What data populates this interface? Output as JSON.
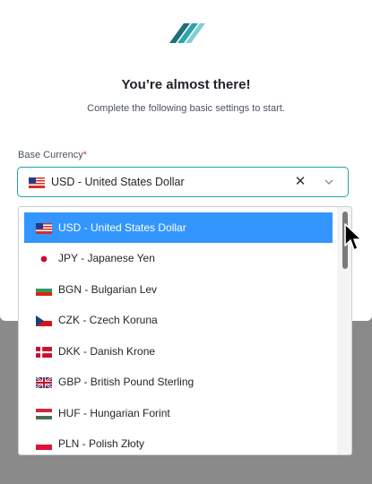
{
  "modal": {
    "title": "You’re almost there!",
    "subtitle": "Complete the following basic settings to start."
  },
  "base_currency": {
    "label": "Base Currency",
    "required_mark": "*",
    "selected_value": "USD - United States Dollar",
    "selected_flag": "us-flag"
  },
  "dropdown": {
    "options": [
      {
        "label": "USD - United States Dollar",
        "flag": "us-flag",
        "selected": true
      },
      {
        "label": "JPY - Japanese Yen",
        "flag": "japan-flag",
        "selected": false
      },
      {
        "label": "BGN - Bulgarian Lev",
        "flag": "bulgaria-flag",
        "selected": false
      },
      {
        "label": "CZK - Czech Koruna",
        "flag": "czech-flag",
        "selected": false
      },
      {
        "label": "DKK - Danish Krone",
        "flag": "denmark-flag",
        "selected": false
      },
      {
        "label": "GBP - British Pound Sterling",
        "flag": "uk-flag",
        "selected": false
      },
      {
        "label": "HUF - Hungarian Forint",
        "flag": "hungary-flag",
        "selected": false
      },
      {
        "label": "PLN - Polish Złoty",
        "flag": "poland-flag",
        "selected": false
      }
    ]
  },
  "colors": {
    "accent": "#1fa3a6",
    "selected_option": "#3396ff",
    "overlay": "#8a8a8a"
  }
}
